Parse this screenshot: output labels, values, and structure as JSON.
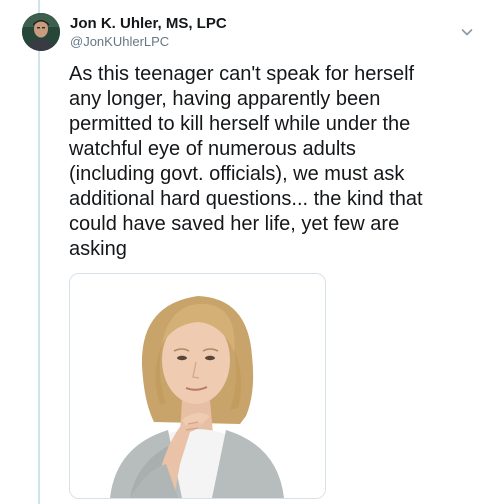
{
  "tweet": {
    "author": {
      "display_name": "Jon K. Uhler, MS, LPC",
      "handle": "@JonKUhlerLPC",
      "avatar_icon": "user-avatar-photo"
    },
    "menu_icon": "chevron-down-icon",
    "text": "As this teenager can't speak for herself\nany longer, having apparently been\npermitted to kill herself while under the\nwatchful eye of numerous adults\n(including govt. officials), we must ask\nadditional hard questions... the kind that\ncould have saved her life, yet few are\nasking",
    "media": {
      "type": "photo",
      "icon": "thinking-woman-photo"
    }
  },
  "colors": {
    "text_primary": "#14171a",
    "text_secondary": "#657786",
    "thread_line": "#cde3ef",
    "media_border": "#d8e1e7"
  }
}
